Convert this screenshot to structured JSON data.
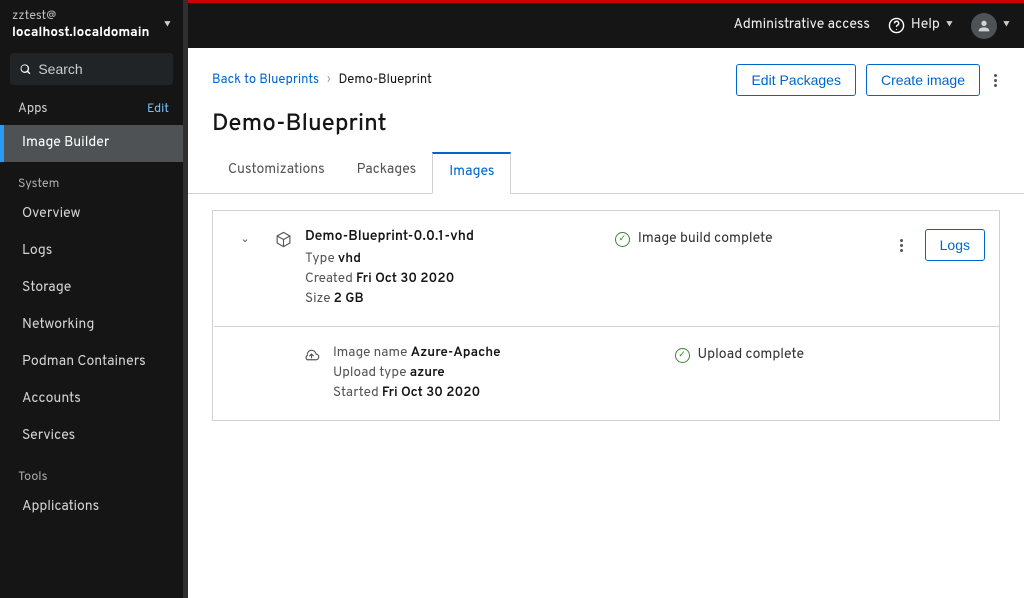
{
  "sidebar": {
    "user": "zztest@",
    "domain": "localhost.localdomain",
    "search_placeholder": "Search",
    "apps_label": "Apps",
    "edit_label": "Edit",
    "image_builder": "Image Builder",
    "system_label": "System",
    "system_items": [
      "Overview",
      "Logs",
      "Storage",
      "Networking",
      "Podman Containers",
      "Accounts",
      "Services"
    ],
    "tools_label": "Tools",
    "tools_items": [
      "Applications"
    ]
  },
  "topbar": {
    "admin": "Administrative access",
    "help": "Help"
  },
  "breadcrumb": {
    "back": "Back to Blueprints",
    "current": "Demo-Blueprint"
  },
  "actions": {
    "edit_packages": "Edit Packages",
    "create_image": "Create image"
  },
  "page_title": "Demo-Blueprint",
  "tabs": {
    "customizations": "Customizations",
    "packages": "Packages",
    "images": "Images"
  },
  "image": {
    "name": "Demo-Blueprint-0.0.1-vhd",
    "type_label": "Type",
    "type": "vhd",
    "created_label": "Created",
    "created": "Fri Oct 30 2020",
    "size_label": "Size",
    "size": "2 GB",
    "status": "Image build complete",
    "logs": "Logs"
  },
  "upload": {
    "img_name_label": "Image name",
    "img_name": "Azure-Apache",
    "type_label": "Upload type",
    "type": "azure",
    "started_label": "Started",
    "started": "Fri Oct 30 2020",
    "status": "Upload complete"
  }
}
